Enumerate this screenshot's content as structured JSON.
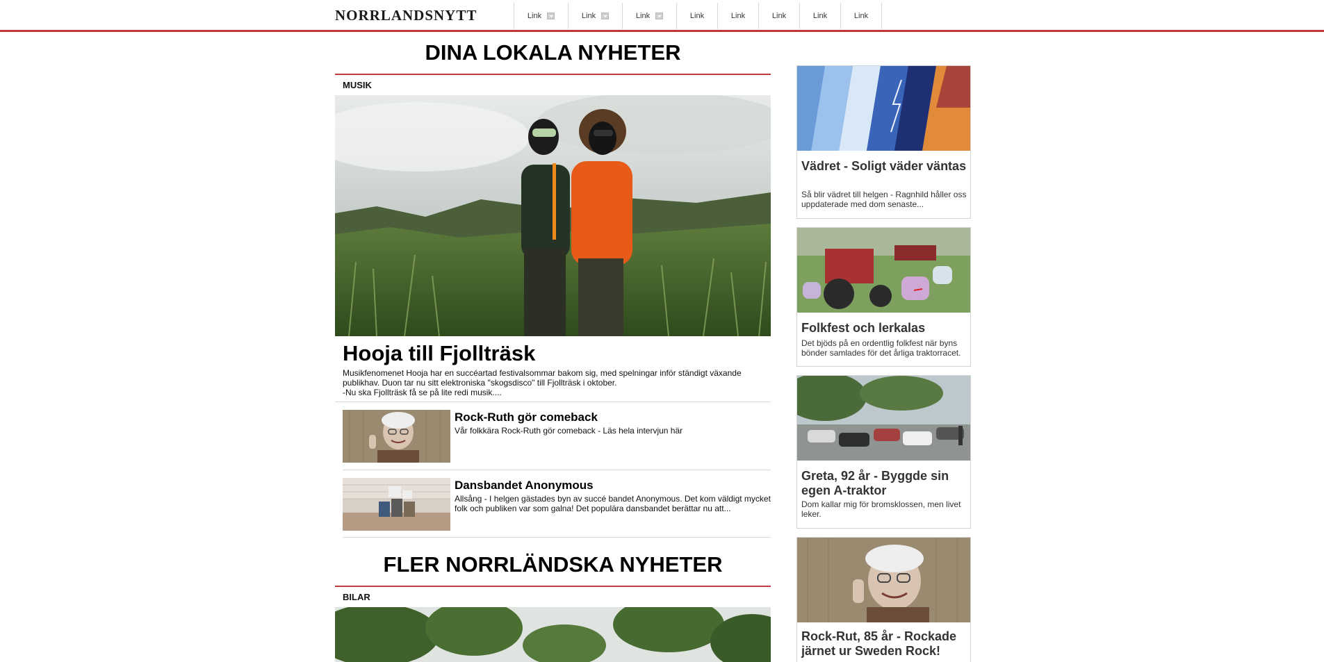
{
  "header": {
    "logo": "NORRLANDSNYTT",
    "nav": [
      {
        "label": "Link",
        "dropdown": true
      },
      {
        "label": "Link",
        "dropdown": true
      },
      {
        "label": "Link",
        "dropdown": true
      },
      {
        "label": "Link",
        "dropdown": false
      },
      {
        "label": "Link",
        "dropdown": false
      },
      {
        "label": "Link",
        "dropdown": false
      },
      {
        "label": "Link",
        "dropdown": false
      },
      {
        "label": "Link",
        "dropdown": false
      }
    ],
    "accent_color": "#c0393f"
  },
  "main": {
    "heading": "DINA LOKALA NYHETER",
    "category": "MUSIK",
    "hero": {
      "title": "Hooja till Fjollträsk",
      "text": [
        "Musikfenomenet Hooja har en succéartad festivalsommar bakom sig, med spelningar inför ständigt växande",
        "publikhav. Duon tar nu sitt elektroniska \"skogsdisco\" till Fjollträsk i oktober.",
        "-Nu ska Fjollträsk få se på lite redi musik...."
      ]
    },
    "list": [
      {
        "title": "Rock-Ruth gör comeback",
        "text": "Vår folkkära Rock-Ruth gör comeback - Läs hela intervjun här"
      },
      {
        "title": "Dansbandet Anonymous",
        "text": "Allsång - I helgen gästades byn av succé bandet Anonymous. Det kom väldigt mycket folk och publiken var som galna! Det populära dansbandet berättar nu att..."
      }
    ],
    "heading2": "FLER NORRLÄNDSKA NYHETER",
    "category2": "BILAR"
  },
  "sidebar": [
    {
      "title": "Vädret - Soligt väder väntas",
      "text": "Så blir vädret till helgen - Ragnhild håller oss uppdaterade med dom senaste..."
    },
    {
      "title": "Folkfest och lerkalas",
      "text": "Det bjöds på en ordentlig folkfest när byns bönder samlades för det årliga traktorracet."
    },
    {
      "title": "Greta, 92 år - Byggde sin egen A-traktor",
      "text": "Dom kallar mig för bromsklossen, men livet leker."
    },
    {
      "title": "Rock-Rut, 85 år - Rockade järnet ur Sweden Rock!",
      "text": ""
    }
  ]
}
